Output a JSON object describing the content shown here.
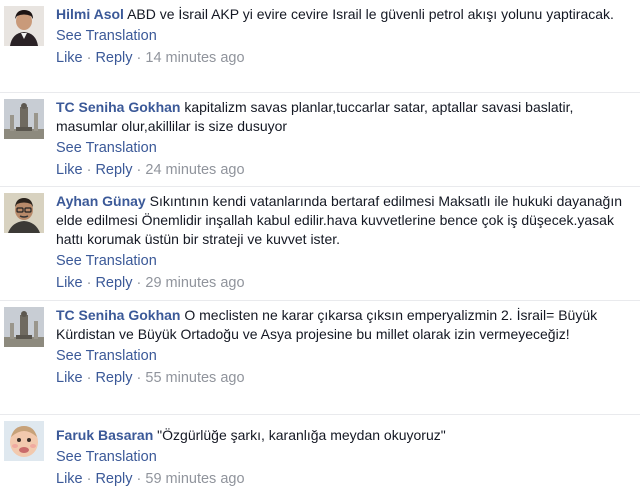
{
  "comments": [
    {
      "author": "Hilmi Asol",
      "text": "ABD ve İsrail AKP yi evire cevire Israil le güvenli petrol akışı yolunu yaptiracak.",
      "translate": "See Translation",
      "like": "Like",
      "reply": "Reply",
      "time": "14 minutes ago",
      "avatar": "portrait-dark-hair-icon"
    },
    {
      "author": "TC Seniha Gokhan",
      "text": "kapitalizm savas planlar,tuccarlar satar, aptallar savasi baslatir, masumlar olur,akillilar is size dusuyor",
      "translate": "See Translation",
      "like": "Like",
      "reply": "Reply",
      "time": "24 minutes ago",
      "avatar": "monument-icon"
    },
    {
      "author": "Ayhan Günay",
      "text": "Sıkıntının kendi vatanlarında bertaraf edilmesi Maksatlı ile hukuki dayanağın elde edilmesi Önemlidir inşallah kabul edilir.hava kuvvetlerine bence çok iş düşecek.yasak hattı korumak üstün bir strateji ve kuvvet ister.",
      "translate": "See Translation",
      "like": "Like",
      "reply": "Reply",
      "time": "29 minutes ago",
      "avatar": "man-with-glasses-icon"
    },
    {
      "author": "TC Seniha Gokhan",
      "text": "O meclisten ne karar çıkarsa çıksın emperyalizmin 2. İsrail= Büyük Kürdistan ve Büyük Ortadoğu ve Asya projesine bu millet olarak izin vermeyeceğiz!",
      "translate": "See Translation",
      "like": "Like",
      "reply": "Reply",
      "time": "55 minutes ago",
      "avatar": "monument-icon"
    },
    {
      "author": "Faruk Basaran",
      "text": "\"Özgürlüğe şarkı, karanlığa meydan okuyoruz\"",
      "translate": "See Translation",
      "like": "Like",
      "reply": "Reply",
      "time": "59 minutes ago",
      "avatar": "baby-face-icon"
    }
  ]
}
